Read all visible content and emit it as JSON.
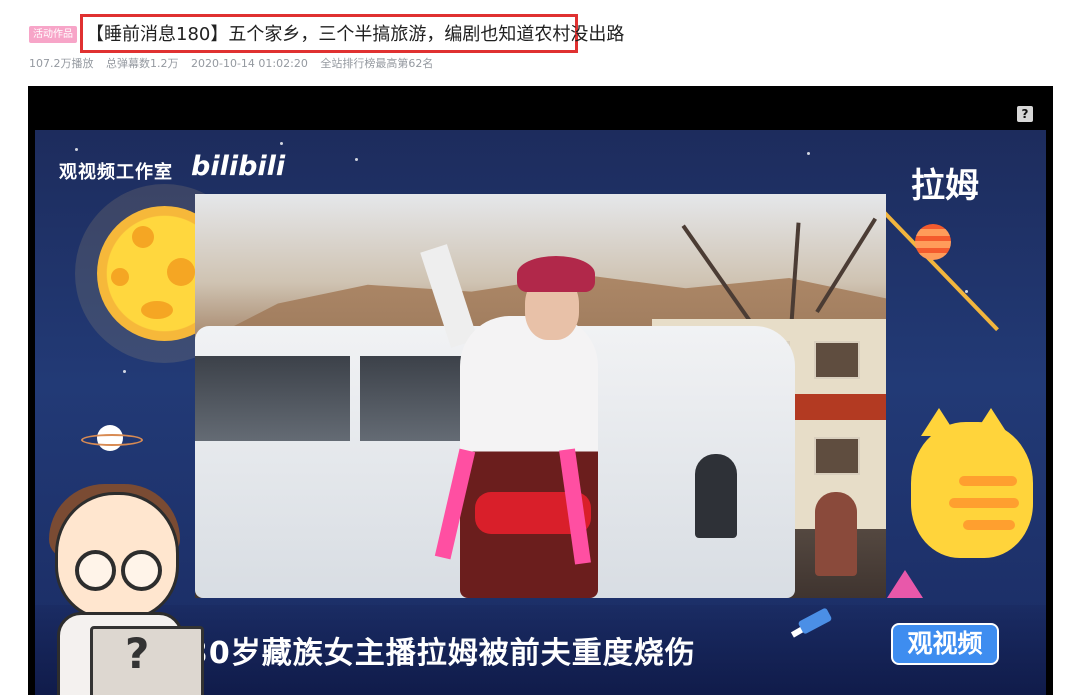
{
  "header": {
    "badge": "活动作品",
    "title": "【睡前消息180】五个家乡，三个半搞旅游，编剧也知道农村没出路",
    "meta": [
      "107.2万播放",
      "总弹幕数1.2万",
      "2020-10-14 01:02:20",
      "全站排行榜最高第62名"
    ]
  },
  "player": {
    "help_icon": "?",
    "studio": "观视频工作室",
    "brand": "bilibili",
    "name": "拉姆",
    "caption": "30岁藏族女主播拉姆被前夫重度烧伤",
    "logo": "观视频"
  },
  "colors": {
    "title_border": "#e03131",
    "badge_bg": "#f7a5c8",
    "player_bg": "#000000"
  }
}
